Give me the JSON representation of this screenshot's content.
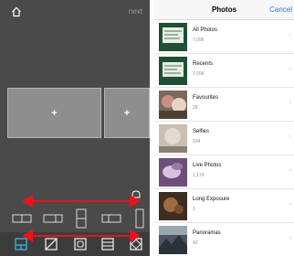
{
  "editor": {
    "next_label": "next",
    "slot_plus": "+"
  },
  "photos": {
    "title": "Photos",
    "cancel_label": "Cancel",
    "albums": [
      {
        "name": "All Photos",
        "count": "7,096"
      },
      {
        "name": "Recents",
        "count": "7,096"
      },
      {
        "name": "Favourites",
        "count": "28"
      },
      {
        "name": "Selfies",
        "count": "234"
      },
      {
        "name": "Live Photos",
        "count": "1,174"
      },
      {
        "name": "Long Exposure",
        "count": "1"
      },
      {
        "name": "Panoramas",
        "count": "42"
      }
    ],
    "chevron": "›"
  },
  "colors": {
    "accent": "#1e7cf6",
    "annotation_red": "#e8141c",
    "editor_bg": "#4a4a4a",
    "toolbar_bg": "#3c3c3c"
  }
}
